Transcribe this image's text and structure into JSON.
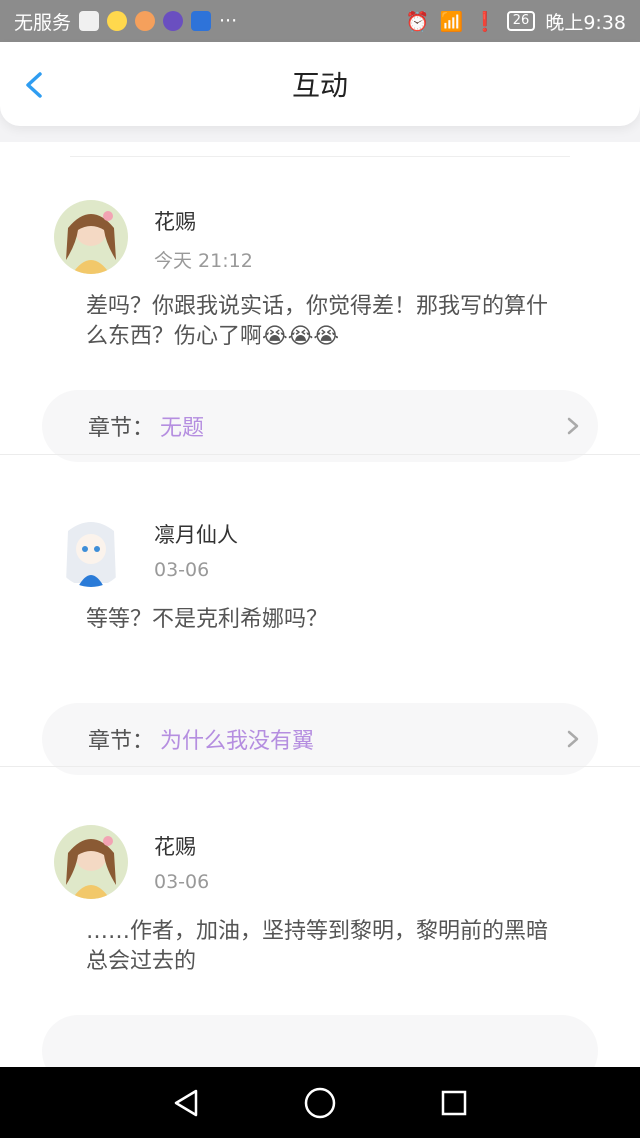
{
  "status_bar": {
    "carrier": "无服务",
    "more": "···",
    "battery": "26",
    "time": "晚上9:38"
  },
  "header": {
    "title": "互动"
  },
  "chapter_label": "章节：",
  "comments": [
    {
      "name": "花赐",
      "time": "今天 21:12",
      "text": "差吗？你跟我说实话，你觉得差！那我写的算什么东西？伤心了啊😭😭😭",
      "chapter": "无题"
    },
    {
      "name": "凛月仙人",
      "time": "03-06",
      "text": "等等？不是克利希娜吗？",
      "chapter": "为什么我没有翼"
    },
    {
      "name": "花赐",
      "time": "03-06",
      "text": "……作者，加油，坚持等到黎明，黎明前的黑暗总会过去的",
      "chapter": ""
    }
  ],
  "colors": {
    "accent": "#2f9df1",
    "chapter_link": "#b58ee0"
  },
  "icons": {
    "back": "chevron-left-icon",
    "chevron": "chevron-right-icon",
    "nav_back": "triangle-back-icon",
    "nav_home": "circle-home-icon",
    "nav_recent": "square-recent-icon"
  }
}
